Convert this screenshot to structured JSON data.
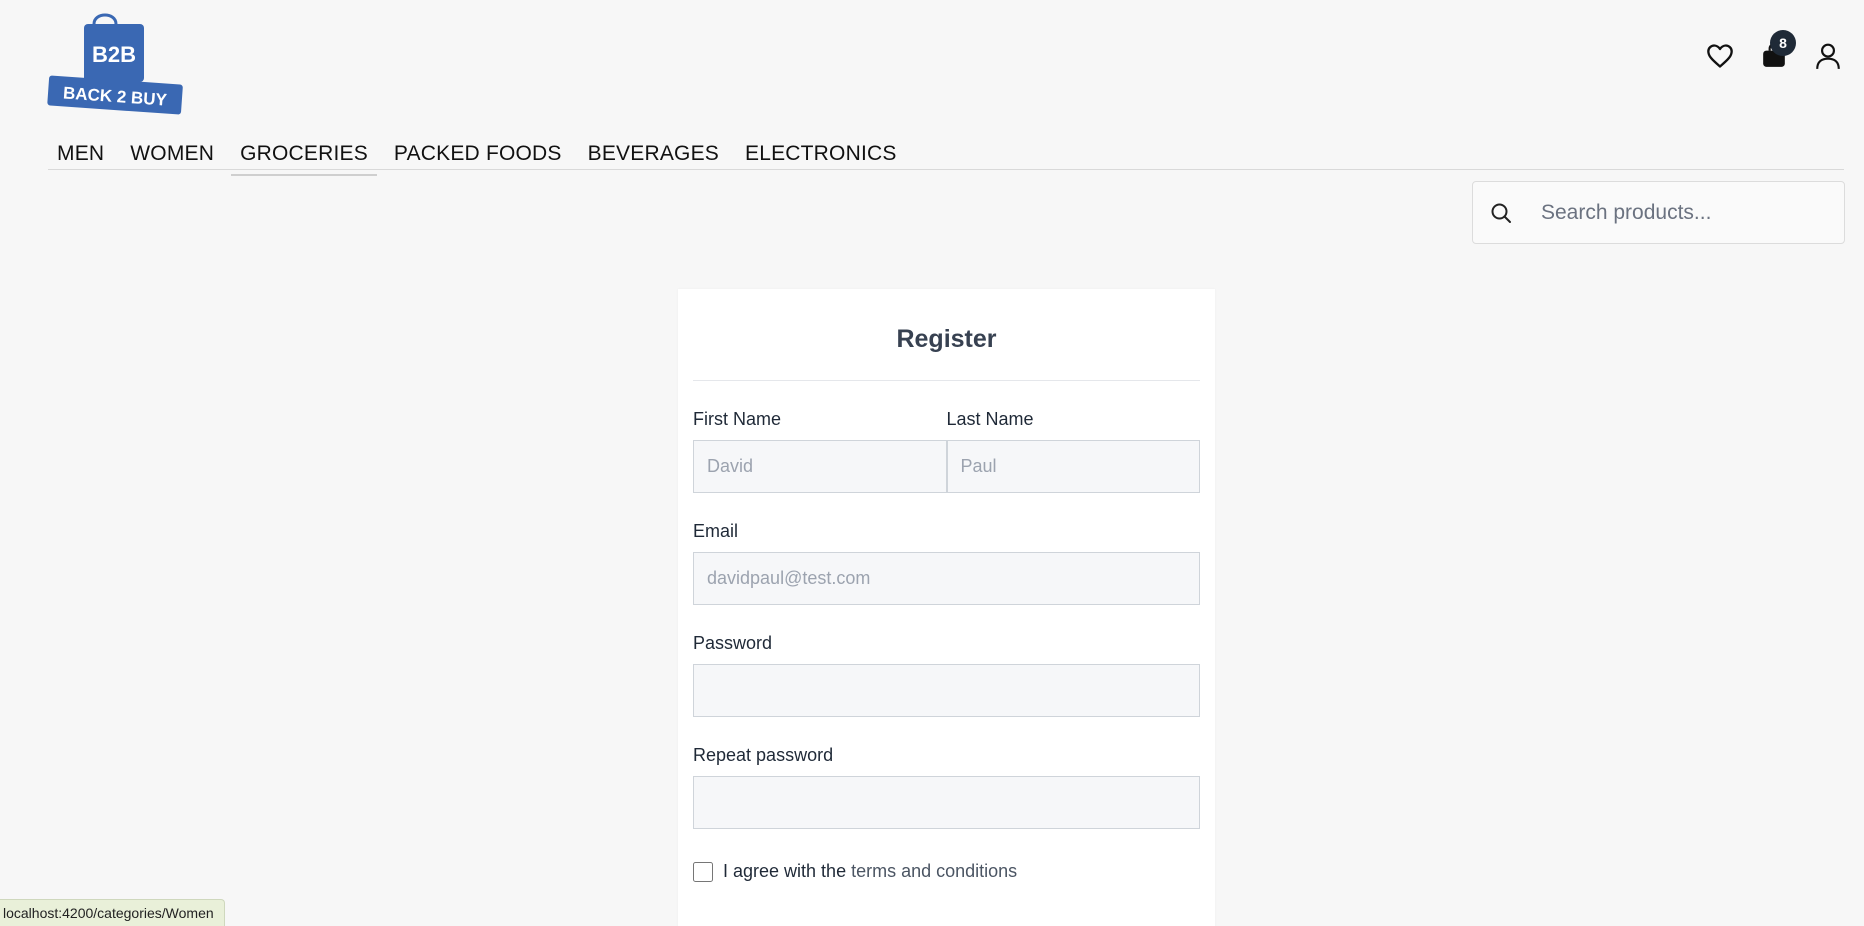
{
  "brand": {
    "logo_mark": "B2B",
    "logo_text": "BACK 2 BUY",
    "accent_color": "#3a68b3"
  },
  "header": {
    "wishlist_icon": "heart-icon",
    "cart_icon": "bag-icon",
    "cart_count": "8",
    "account_icon": "user-icon"
  },
  "nav": {
    "items": [
      {
        "label": "MEN"
      },
      {
        "label": "WOMEN"
      },
      {
        "label": "GROCERIES"
      },
      {
        "label": "PACKED FOODS"
      },
      {
        "label": "BEVERAGES"
      },
      {
        "label": "ELECTRONICS"
      }
    ],
    "active": "GROCERIES"
  },
  "search": {
    "placeholder": "Search products..."
  },
  "form": {
    "title": "Register",
    "first_name_label": "First Name",
    "first_name_placeholder": "David",
    "last_name_label": "Last Name",
    "last_name_placeholder": "Paul",
    "email_label": "Email",
    "email_placeholder": "davidpaul@test.com",
    "password_label": "Password",
    "repeat_password_label": "Repeat password",
    "agree_text": "I agree with the",
    "terms_text": "terms and conditions"
  },
  "status_bar": {
    "url": "localhost:4200/categories/Women"
  }
}
